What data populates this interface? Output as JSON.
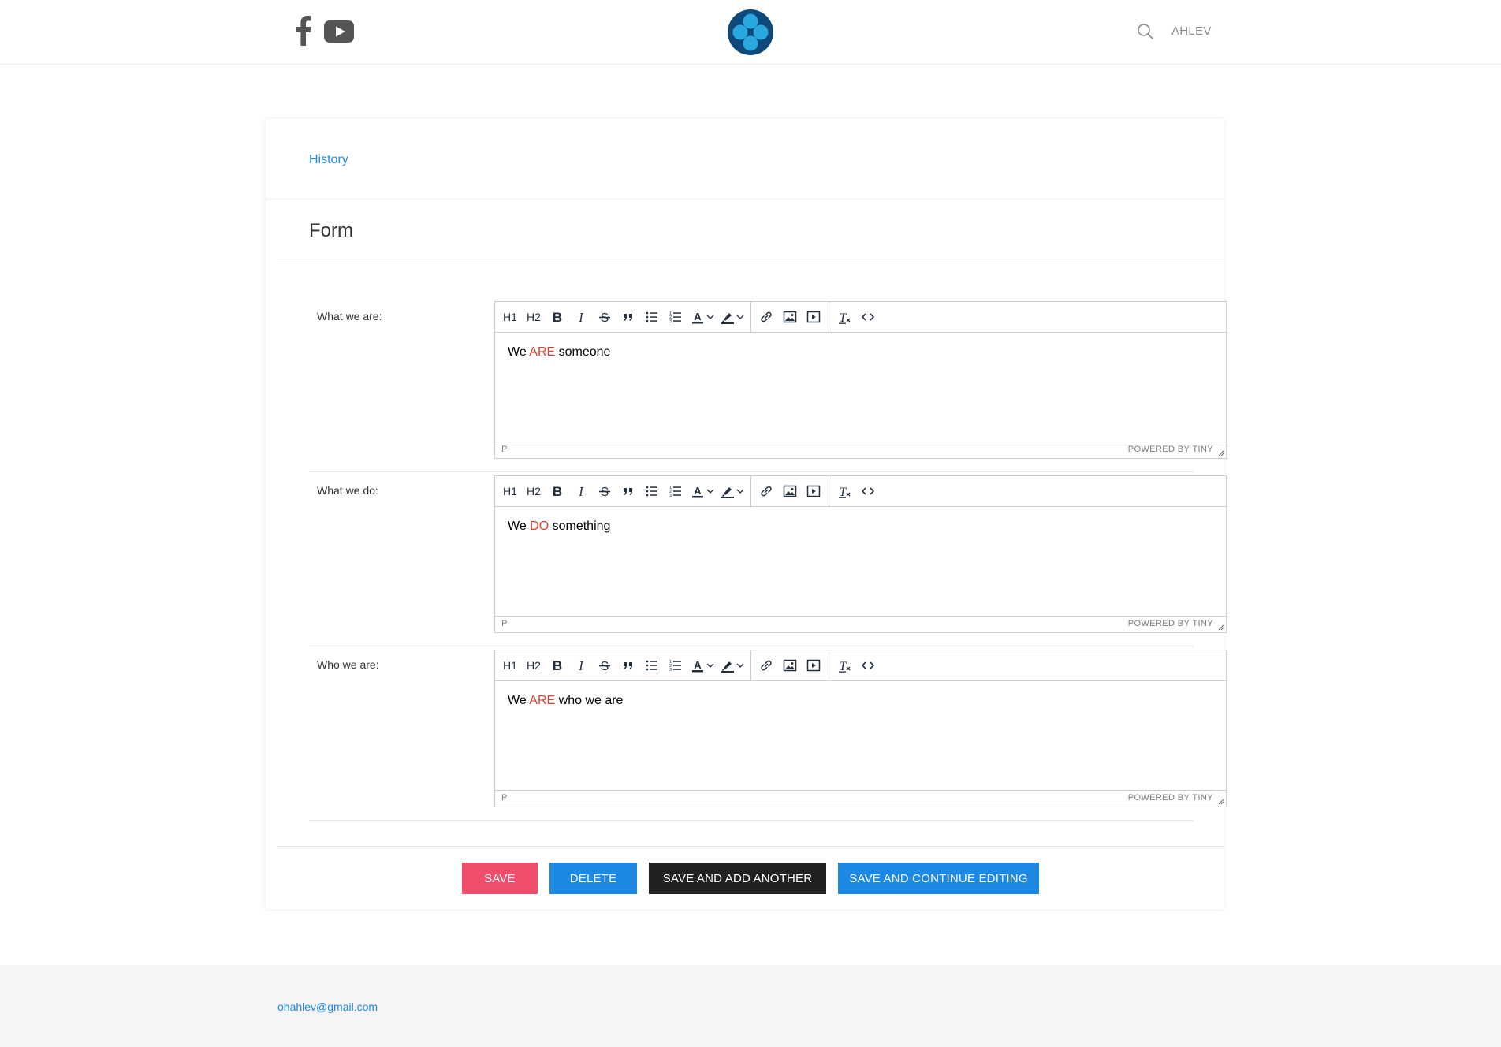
{
  "header": {
    "social": [
      "facebook-icon",
      "youtube-icon"
    ],
    "logo": "logo-icon",
    "search_icon": "search-icon",
    "user": "AHLEV"
  },
  "history_link": "History",
  "form": {
    "title": "Form",
    "toolbar": {
      "h1": "H1",
      "h2": "H2",
      "icons": [
        "bold-icon",
        "italic-icon",
        "strikethrough-icon",
        "blockquote-icon",
        "bullet-list-icon",
        "numbered-list-icon",
        "text-color-icon",
        "highlight-color-icon",
        "link-icon",
        "image-icon",
        "media-icon",
        "clear-formatting-icon",
        "source-code-icon"
      ]
    },
    "fields": [
      {
        "label": "What we are:",
        "text_before": "We ",
        "text_highlight": "ARE",
        "text_after": " someone",
        "path": "P",
        "branding": "POWERED BY TINY"
      },
      {
        "label": "What we do:",
        "text_before": "We ",
        "text_highlight": "DO",
        "text_after": " something",
        "path": "P",
        "branding": "POWERED BY TINY"
      },
      {
        "label": "Who we are:",
        "text_before": "We ",
        "text_highlight": "ARE",
        "text_after": " who we are",
        "path": "P",
        "branding": "POWERED BY TINY"
      }
    ],
    "highlight_color": "#e03e2d"
  },
  "actions": {
    "save": "SAVE",
    "delete": "DELETE",
    "save_add": "SAVE AND ADD ANOTHER",
    "save_continue": "SAVE AND CONTINUE EDITING",
    "colors": {
      "save": "#f04c6c",
      "delete": "#1e88e5",
      "save_add": "#212121",
      "save_continue": "#1e88e5"
    }
  },
  "footer": {
    "email": "ohahlev@gmail.com"
  }
}
